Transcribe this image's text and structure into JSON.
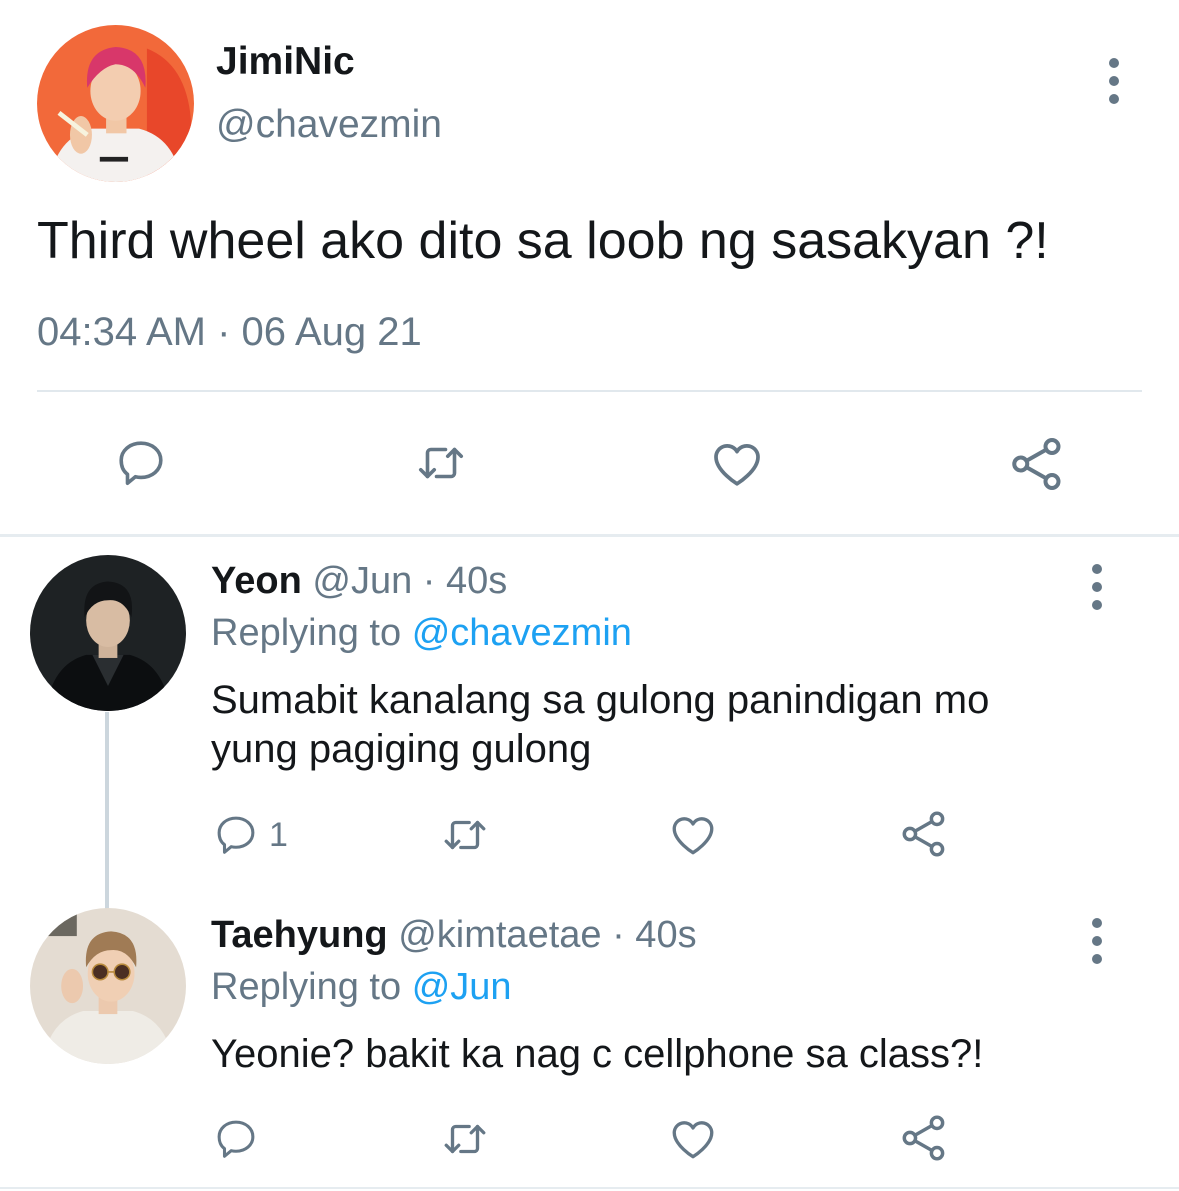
{
  "main_tweet": {
    "display_name": "JimiNic",
    "handle": "@chavezmin",
    "text": "Third wheel ako dito sa loob ng sasakyan ?!",
    "timestamp": "04:34 AM · 06 Aug 21",
    "actions": [
      "reply-icon",
      "retweet-icon",
      "like-icon",
      "share-icon"
    ],
    "avatar_bg": "#f2693a"
  },
  "replies": [
    {
      "display_name": "Yeon",
      "handle": "@Jun",
      "time": "· 40s",
      "replying_prefix": "Replying to",
      "replying_handle": "@chavezmin",
      "text_line1": "Sumabit kanalang sa gulong panindigan mo",
      "text_line2": "yung pagiging gulong",
      "reply_count": "1",
      "avatar_bg": "#1e2224"
    },
    {
      "display_name": "Taehyung",
      "handle": "@kimtaetae",
      "time": "· 40s",
      "replying_prefix": "Replying to",
      "replying_handle": "@Jun",
      "text": "Yeonie? bakit ka nag c cellphone sa class?!",
      "avatar_bg": "#e4dcd2"
    }
  ],
  "colors": {
    "accent": "#1da1f2",
    "secondary_text": "#657786",
    "divider": "#e1e8ed",
    "thread_line": "#ccd6dd"
  }
}
